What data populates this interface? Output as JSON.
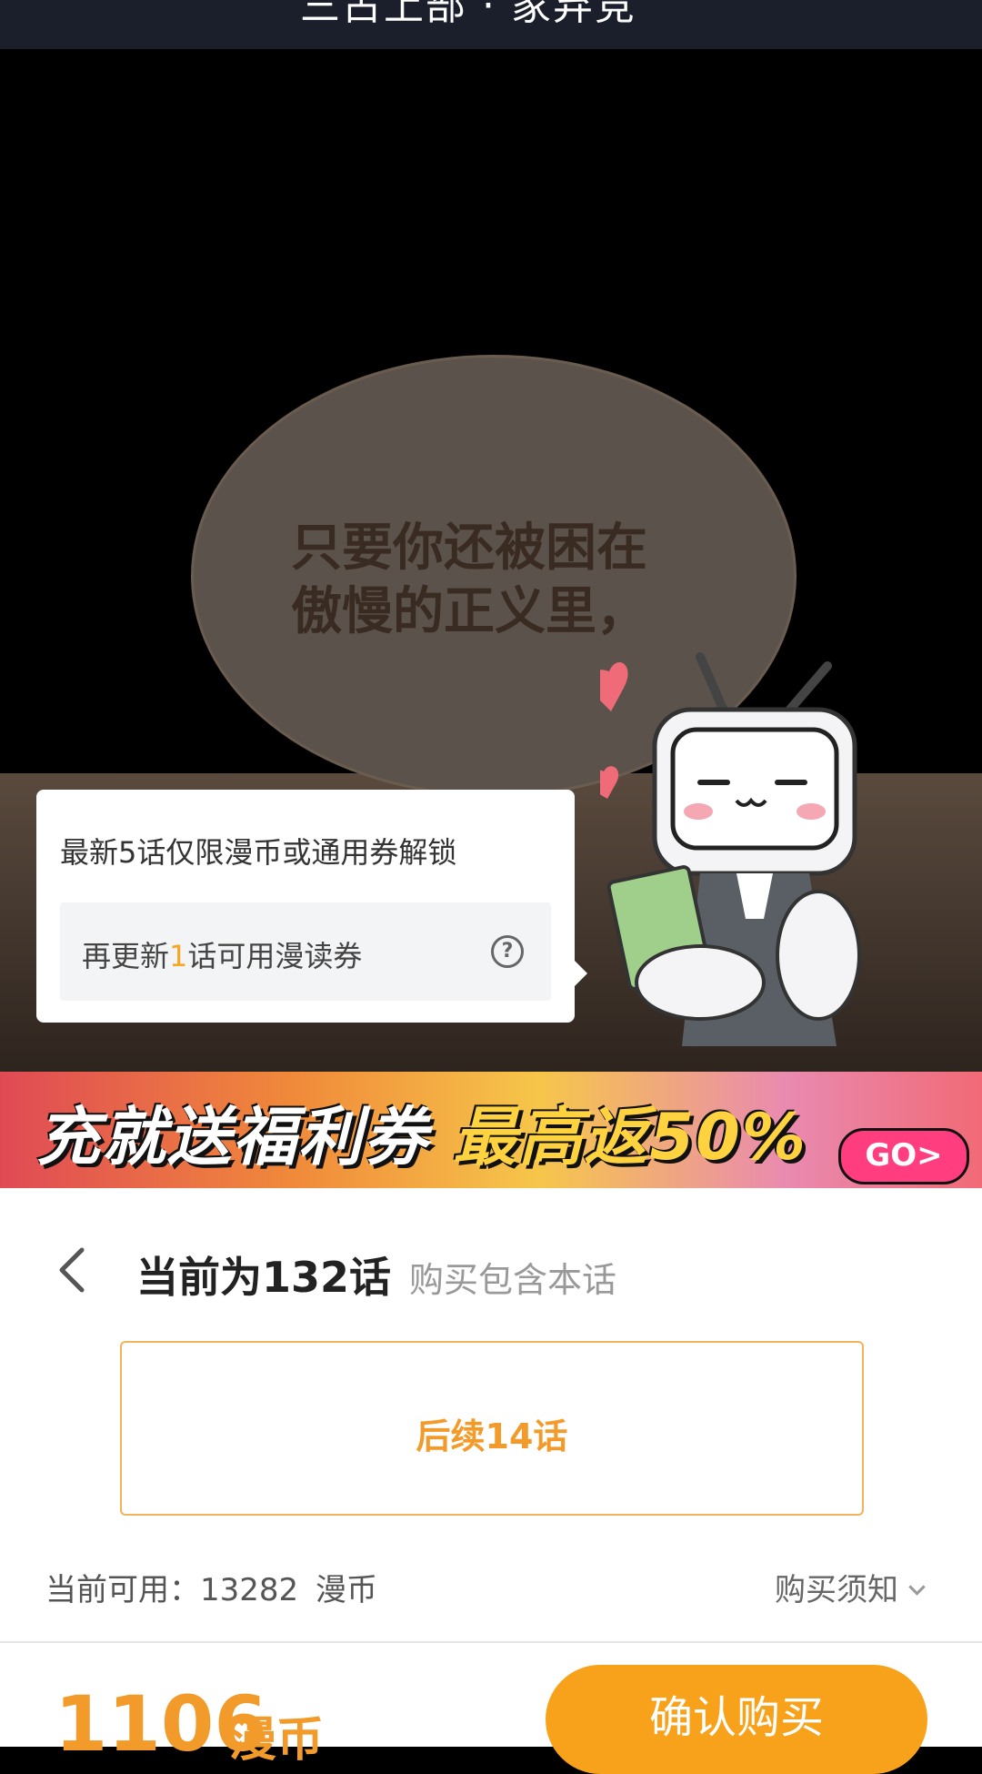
{
  "header": {
    "title": "三占上部 · 家弃竞"
  },
  "comic": {
    "bubble_text_line1": "只要你还被困在",
    "bubble_text_line2": "傲慢的正义里，"
  },
  "popover": {
    "title": "最新5话仅限漫币或通用券解锁",
    "hint_prefix": "再更新",
    "hint_number": "1",
    "hint_suffix": "话可用漫读券",
    "help_icon_text": "?"
  },
  "banner": {
    "text_main": "充就送福利券",
    "text_hl": "最高返50%",
    "go_label": "GO>"
  },
  "panel": {
    "title": "当前为132话",
    "subtitle": "购买包含本话",
    "option_label": "后续14话",
    "balance_label": "当前可用：",
    "balance_value": "13282",
    "balance_unit": "漫币",
    "notice_label": "购买须知",
    "price_value": "1106",
    "price_unit": "漫币",
    "confirm_label": "确认购买"
  },
  "colors": {
    "accent": "#f8a21b",
    "accent_text": "#f29b2b",
    "highlight": "#f5a623"
  }
}
